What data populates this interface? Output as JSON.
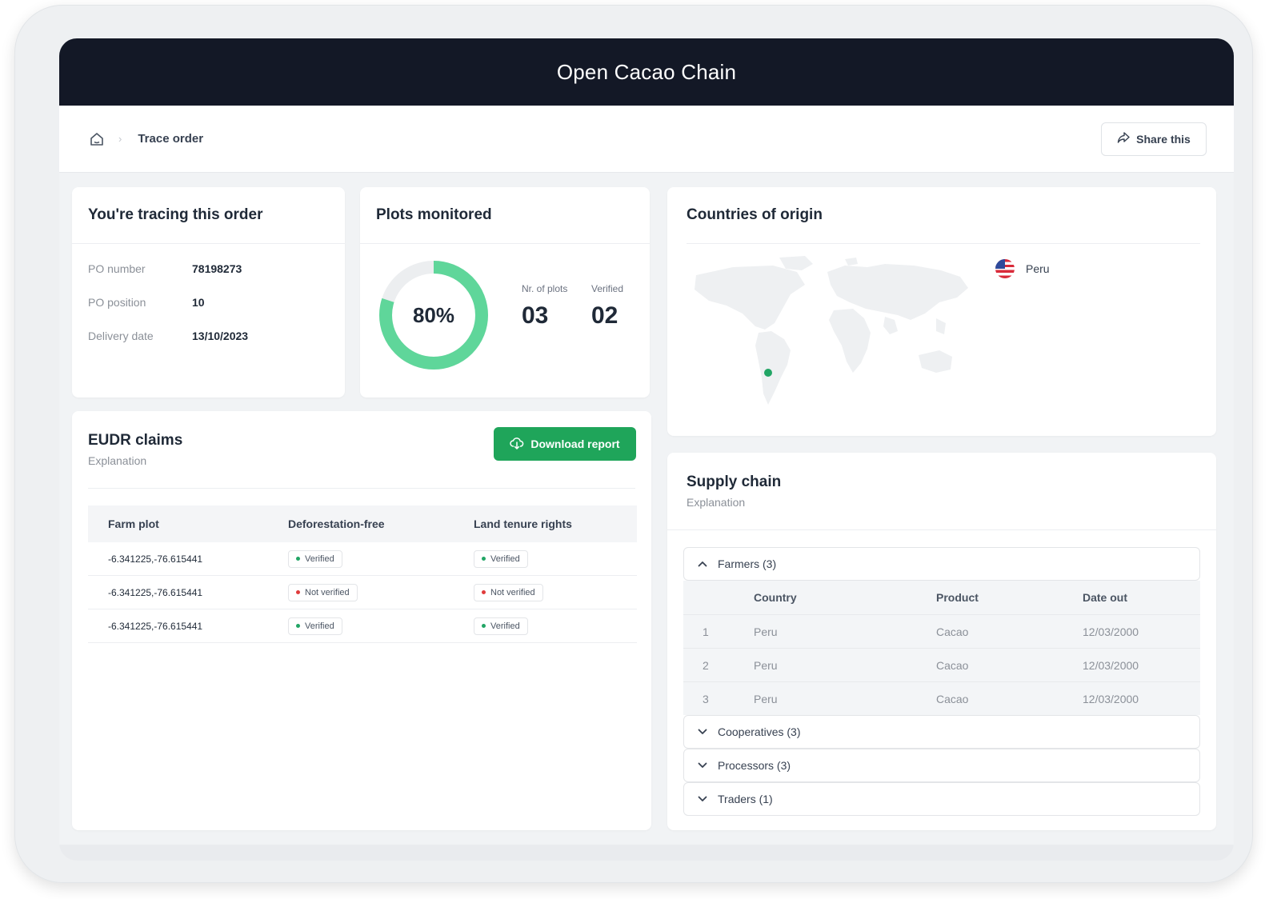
{
  "app": {
    "title": "Open Cacao Chain"
  },
  "breadcrumb": {
    "current": "Trace order"
  },
  "actions": {
    "share_label": "Share this"
  },
  "order": {
    "title": "You're tracing this order",
    "fields": [
      {
        "label": "PO number",
        "value": "78198273"
      },
      {
        "label": "PO position",
        "value": "10"
      },
      {
        "label": "Delivery date",
        "value": "13/10/2023"
      }
    ]
  },
  "plots": {
    "title": "Plots monitored",
    "percent_label": "80%",
    "percent_value": 0.8,
    "nr_plots_label": "Nr. of plots",
    "nr_plots_value": "03",
    "verified_label": "Verified",
    "verified_value": "02"
  },
  "countries": {
    "title": "Countries of origin",
    "items": [
      {
        "name": "Peru",
        "flag": "us-flag-icon"
      }
    ]
  },
  "eudr": {
    "title": "EUDR claims",
    "subtitle": "Explanation",
    "download_label": "Download report",
    "headers": [
      "Farm plot",
      "Deforestation-free",
      "Land tenure rights"
    ],
    "rows": [
      {
        "plot": "-6.341225,-76.615441",
        "deforestation": "Verified",
        "deforestation_status": "ok",
        "land": "Verified",
        "land_status": "ok"
      },
      {
        "plot": "-6.341225,-76.615441",
        "deforestation": "Not verified",
        "deforestation_status": "bad",
        "land": "Not verified",
        "land_status": "bad"
      },
      {
        "plot": "-6.341225,-76.615441",
        "deforestation": "Verified",
        "deforestation_status": "ok",
        "land": "Verified",
        "land_status": "ok"
      }
    ]
  },
  "supply": {
    "title": "Supply chain",
    "subtitle": "Explanation",
    "sections": {
      "farmers": "Farmers (3)",
      "cooperatives": "Cooperatives (3)",
      "processors": "Processors (3)",
      "traders": "Traders (1)"
    },
    "headers": [
      "",
      "Country",
      "Product",
      "Date out"
    ],
    "rows": [
      {
        "n": "1",
        "country": "Peru",
        "product": "Cacao",
        "date": "12/03/2000"
      },
      {
        "n": "2",
        "country": "Peru",
        "product": "Cacao",
        "date": "12/03/2000"
      },
      {
        "n": "3",
        "country": "Peru",
        "product": "Cacao",
        "date": "12/03/2000"
      }
    ]
  },
  "colors": {
    "accent": "#1fa55a",
    "donut": "#5fd69a",
    "verified": "#22a565",
    "not_verified": "#e03b3b",
    "topbar": "#131826"
  }
}
